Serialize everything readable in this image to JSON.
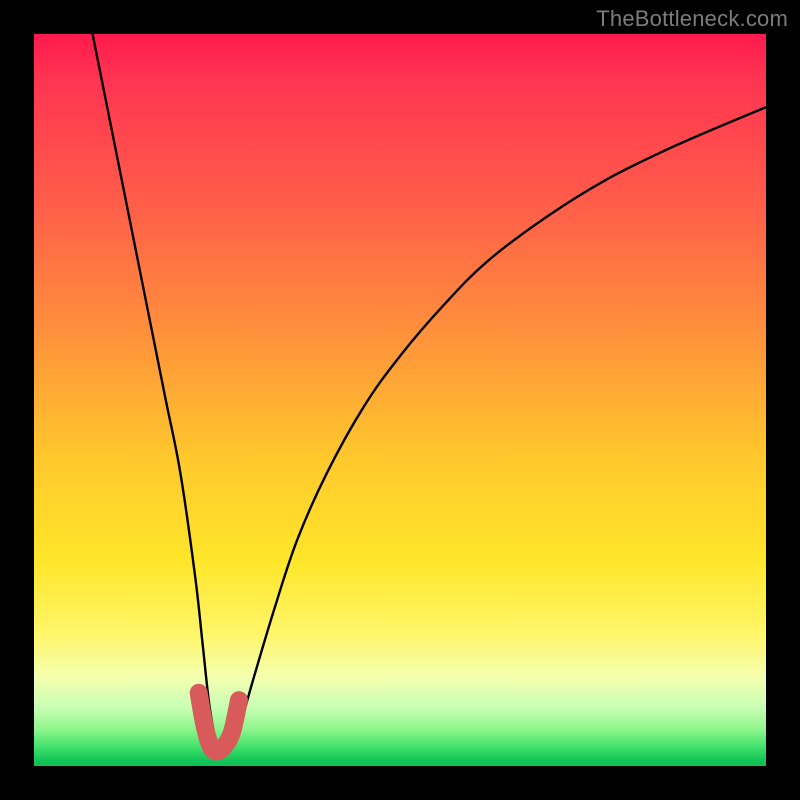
{
  "watermark": "TheBottleneck.com",
  "colors": {
    "frame": "#000000",
    "gradient_top": "#ff1a4d",
    "gradient_bottom": "#0fbf55",
    "curve": "#000000",
    "highlight_stroke": "#d85a5a"
  },
  "chart_data": {
    "type": "line",
    "title": "",
    "xlabel": "",
    "ylabel": "",
    "xlim": [
      0,
      100
    ],
    "ylim": [
      0,
      100
    ],
    "grid": false,
    "series": [
      {
        "name": "bottleneck-curve",
        "x": [
          8,
          10,
          12,
          14,
          16,
          18,
          20,
          22,
          23,
          24,
          25,
          26,
          27,
          28,
          30,
          33,
          36,
          40,
          45,
          50,
          56,
          62,
          70,
          78,
          86,
          94,
          100
        ],
        "values": [
          100,
          90,
          80,
          70,
          60,
          50,
          40,
          26,
          17,
          8,
          3,
          2,
          2.5,
          5,
          12,
          22,
          31,
          40,
          49,
          56,
          63,
          69,
          75,
          80,
          84,
          87.5,
          90
        ]
      }
    ],
    "highlight_segment": {
      "name": "optimal-zone",
      "x": [
        22.5,
        23.2,
        24.0,
        24.8,
        25.8,
        27.0,
        28.0
      ],
      "values": [
        10.0,
        6.0,
        3.0,
        2.0,
        2.5,
        4.5,
        9.0
      ]
    }
  }
}
